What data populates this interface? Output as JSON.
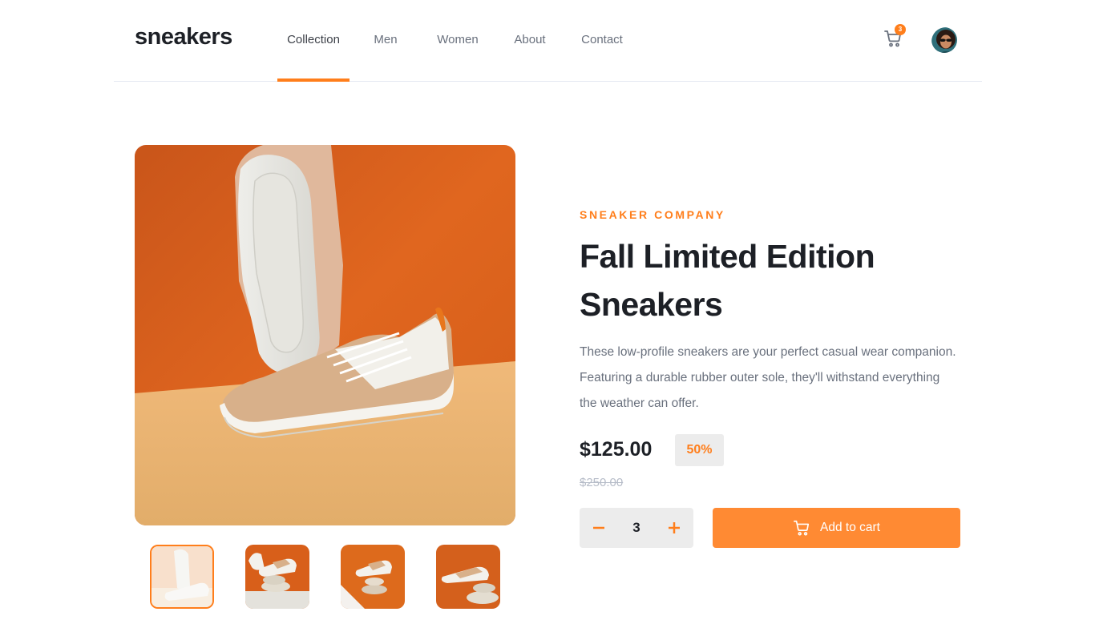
{
  "header": {
    "logo": "sneakers",
    "nav": [
      {
        "label": "Collection",
        "active": true
      },
      {
        "label": "Men",
        "active": false
      },
      {
        "label": "Women",
        "active": false
      },
      {
        "label": "About",
        "active": false
      },
      {
        "label": "Contact",
        "active": false
      }
    ],
    "cart_count": "3"
  },
  "product": {
    "company": "SNEAKER COMPANY",
    "title_line1": "Fall Limited Edition",
    "title_line2": "Sneakers",
    "description": "These low-profile sneakers are your perfect casual wear companion. Featuring a durable rubber outer sole, they'll withstand everything the weather can offer.",
    "price": "$125.00",
    "discount": "50%",
    "old_price": "$250.00",
    "quantity": "3",
    "add_to_cart_label": "Add to cart"
  },
  "colors": {
    "accent": "#ff7e1b",
    "button": "#ff8a33",
    "text_dark": "#1d2026",
    "text_muted": "#69707d"
  }
}
